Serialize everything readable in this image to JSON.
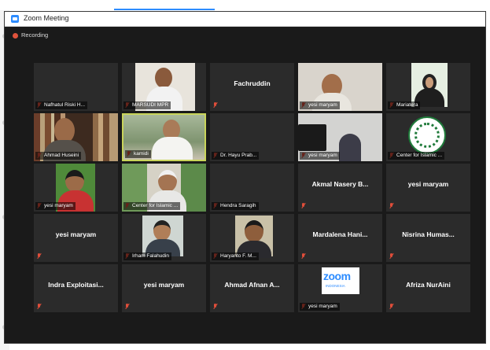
{
  "window": {
    "title": "Zoom Meeting"
  },
  "recording": {
    "label": "Recording"
  },
  "tiles": [
    {
      "label": "Nafhatul Riski H..."
    },
    {
      "label": "MARSUDI MPR"
    },
    {
      "name": "Fachruddin"
    },
    {
      "label": "yesi maryam"
    },
    {
      "label": "Mariatera"
    },
    {
      "label": "Ahmad Huseini"
    },
    {
      "label": "kamidi"
    },
    {
      "label": "Dr. Hayu Prab..."
    },
    {
      "label": "yesi maryam"
    },
    {
      "label": "Center for Islamic ..."
    },
    {
      "label": "yesi maryam"
    },
    {
      "label": "Center for Islamic ..."
    },
    {
      "label": "Hendra Saragih"
    },
    {
      "name": "Akmal Nasery B..."
    },
    {
      "name": "yesi maryam"
    },
    {
      "name": "yesi maryam"
    },
    {
      "label": "Irham Falahudin"
    },
    {
      "label": "Haryanto F. M..."
    },
    {
      "name": "Mardalena Hani..."
    },
    {
      "name": "Nisrina Humas..."
    },
    {
      "name": "Indra Exploitasi..."
    },
    {
      "name": "yesi maryam"
    },
    {
      "name": "Ahmad Afnan A..."
    },
    {
      "label": "yesi maryam"
    },
    {
      "name": "Afriza NurAini"
    }
  ],
  "zoom_logo": {
    "word": "zoom",
    "sub": "INDONESIA"
  },
  "icons": {
    "app": "zoom-app-icon",
    "record": "record-dot-icon",
    "mute": "mic-muted-icon"
  },
  "colors": {
    "accent": "#2d8cff",
    "active_border": "#c9d45a",
    "tile_bg": "#2b2b2b",
    "muted": "#e04e3a"
  }
}
